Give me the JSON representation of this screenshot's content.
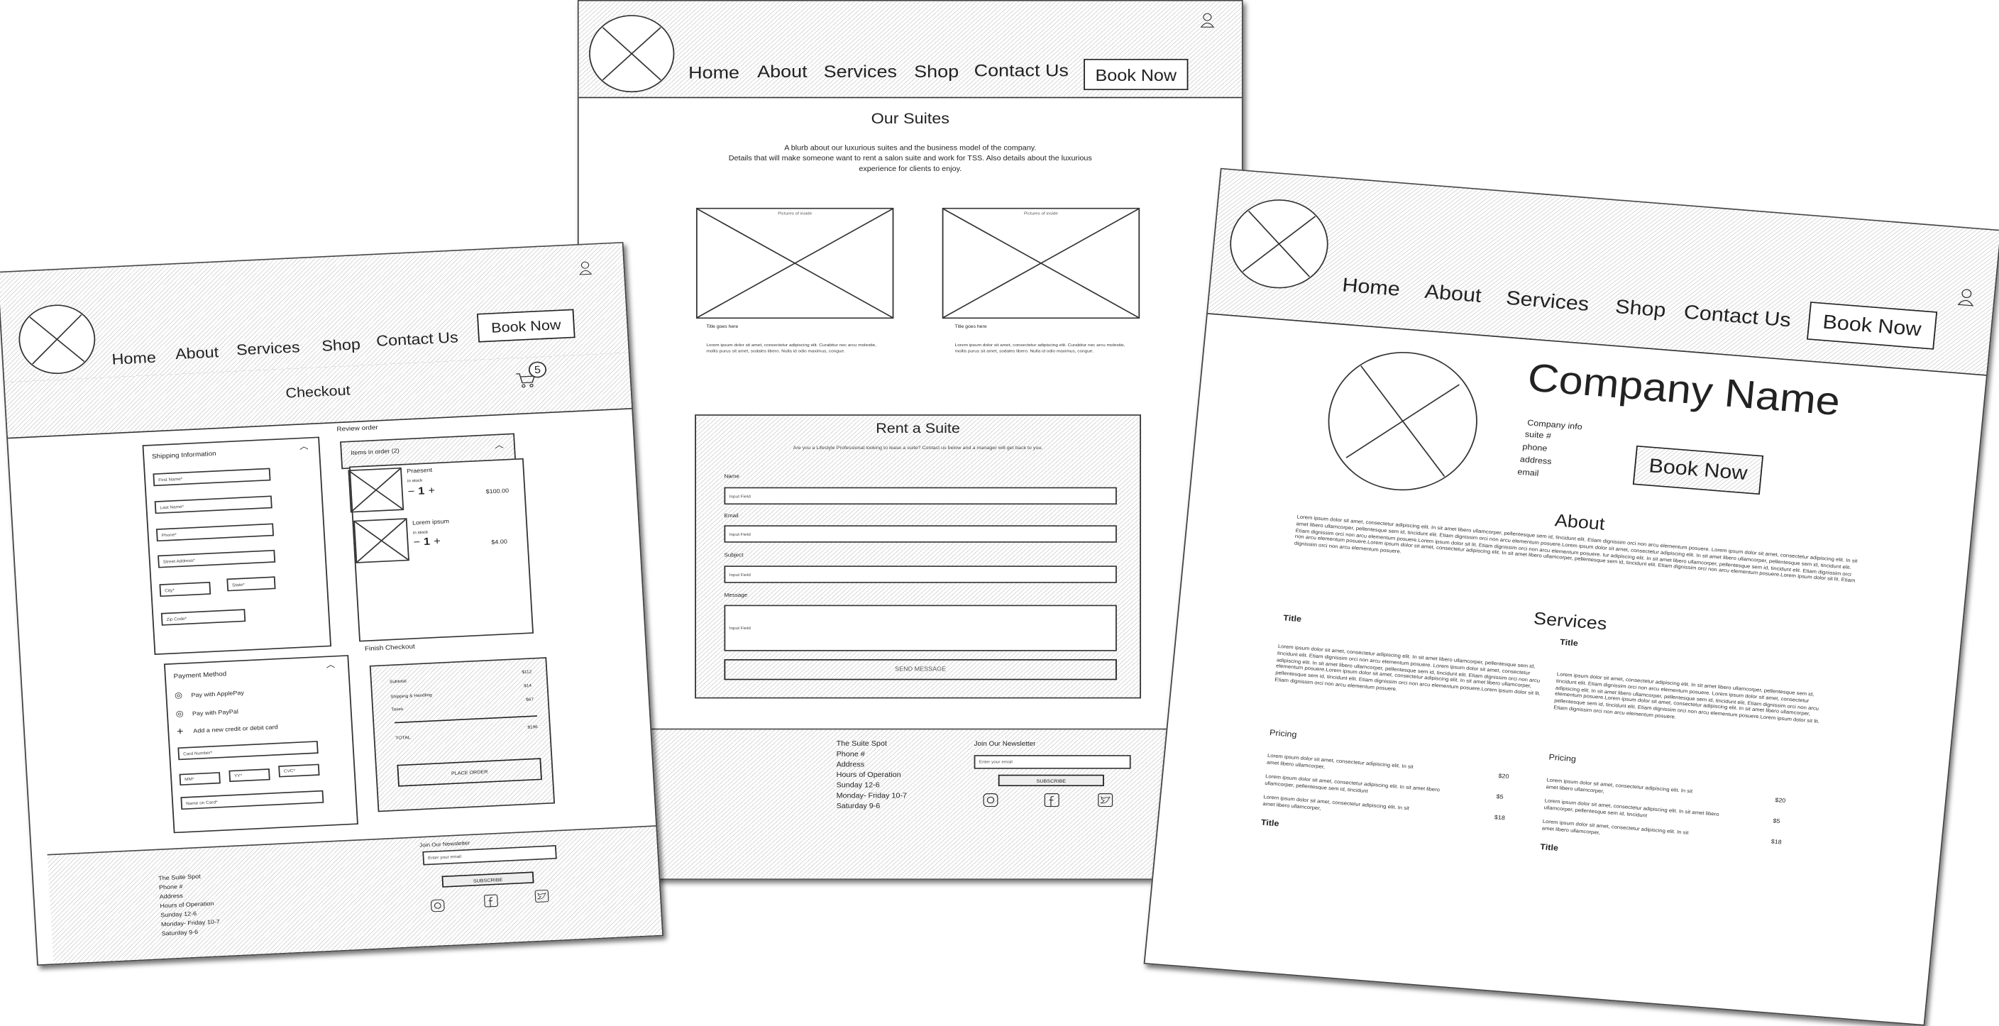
{
  "nav": [
    "Home",
    "About",
    "Services",
    "Shop",
    "Contact Us"
  ],
  "book_now": "Book Now",
  "footer": {
    "lines": [
      "The Suite Spot",
      "Phone #",
      "Address",
      "Hours of Operation",
      "Sunday 12-6",
      "Monday- Friday 10-7",
      "Saturday 9-6"
    ],
    "newsletter_label": "Join Our Newsletter",
    "email_placeholder": "Enter your email",
    "subscribe": "SUBSCRIBE",
    "social_icons": [
      "instagram-icon",
      "facebook-icon",
      "twitter-icon"
    ]
  },
  "checkout_page": {
    "title": "Checkout",
    "cart_count": "5",
    "shipping": {
      "title": "Shipping Information",
      "fields": [
        "First Name*",
        "Last Name*",
        "Phone*",
        "Street Address*",
        "City*",
        "State*",
        "Zip Code*"
      ]
    },
    "review": {
      "label": "Review order",
      "items_header": "Items in order (2)",
      "items": [
        {
          "name": "Praesent",
          "stock": "in stock",
          "qty": "1",
          "price": "$100.00"
        },
        {
          "name": "Lorem ipsum",
          "stock": "in stock",
          "qty": "1",
          "price": "$4.00"
        }
      ]
    },
    "payment": {
      "title": "Payment Method",
      "options": [
        "Pay with ApplePay",
        "Pay with PayPal"
      ],
      "add_card": "Add a new credit or debit card",
      "fields": [
        "Card Number*",
        "MM*",
        "YY*",
        "CVC*",
        "Name on Card*"
      ]
    },
    "finish": {
      "label": "Finish Checkout",
      "rows": [
        {
          "label": "Subtotal",
          "value": "$112"
        },
        {
          "label": "Shipping & Handling",
          "value": "$14"
        },
        {
          "label": "Taxes",
          "value": "$67"
        }
      ],
      "total_label": "TOTAL",
      "total_value": "$196",
      "place_order": "PLACE ORDER"
    }
  },
  "suites_page": {
    "title": "Our Suites",
    "blurb": [
      "A blurb about our luxurious suites and the business model of the company.",
      "Details that will make someone want to rent a salon suite and work for TSS. Also details about the luxurious",
      "experience for clients to enjoy."
    ],
    "cards": [
      {
        "caption": "Pictures of inside",
        "title": "Title goes here",
        "text": "Lorem ipsum dolor sit amet, consectetur adipiscing elit. Curabitur nec arcu molestie, mollis purus sit amet, sodales libero. Nulla id odio maximus, congue."
      },
      {
        "caption": "Pictures of inside",
        "title": "Title goes here",
        "text": "Lorem ipsum dolor sit amet, consectetur adipiscing elit. Curabitur nec arcu molestie, mollis purus sit amet, sodales libero. Nulla id odio maximus, congue."
      }
    ],
    "rent": {
      "title": "Rent a Suite",
      "subtitle": "Are you a Lifestyle Professional looking to lease a suite? Contact us below and a manager will get back to you.",
      "fields": [
        {
          "label": "Name",
          "placeholder": "Input Field"
        },
        {
          "label": "Email",
          "placeholder": "Input Field"
        },
        {
          "label": "Subject",
          "placeholder": "Input Field"
        },
        {
          "label": "Message",
          "placeholder": "Input Field"
        }
      ],
      "send": "SEND MESSAGE"
    }
  },
  "home_page": {
    "company_name": "Company Name",
    "info": [
      "Company info",
      "suite #",
      "phone",
      "address",
      "email"
    ],
    "about_title": "About",
    "about_text": "Lorem ipsum dolor sit amet, consectetur adipiscing elit. In sit amet libero ullamcorper, pellentesque sem id, tincidunt elit. Etiam dignissim orci non arcu elementum posuere. Lorem ipsum dolor sit amet, consectetur adipiscing elit. In sit amet libero ullamcorper, pellentesque sem id, tincidunt elit. Etiam dignissim orci non arcu elementum posuere.Lorem ipsum dolor sit amet, consectetur adipiscing elit. In sit amet libero ullamcorper, pellentesque sem id, tincidunt elit. Etiam dignissim orci non arcu elementum posuere.Lorem ipsum dolor sit lit. Etiam dignissim orci non arcu elementum posuere. tur adipiscing elit. In sit amet libero ullamcorper, pellentesque sem id, tincidunt elit. Etiam dignissim orci non arcu elementum posuere.Lorem ipsum dolor sit amet, consectetur adipiscing elit. In sit amet libero ullamcorper, pellentesque sem id, tincidunt elit. Etiam dignissim orci non arcu elementum posuere.Lorem ipsum dolor sit lit. Etiam dignissim orci non arcu elementum posuere.",
    "services_title": "Services",
    "columns": [
      {
        "title": "Title",
        "text": "Lorem ipsum dolor sit amet, consectetur adipiscing elit. In sit amet libero ullamcorper, pellentesque sem id, tincidunt elit. Etiam dignissim orci non arcu elementum posuere. Lorem ipsum dolor sit amet, consectetur adipiscing elit. In sit amet libero ullamcorper, pellentesque sem id, tincidunt elit. Etiam dignissim orci non arcu elementum posuere.Lorem ipsum dolor sit amet, consectetur adipiscing elit. In sit amet libero ullamcorper, pellentesque sem id, tincidunt elit. Etiam dignissim orci non arcu elementum posuere.Lorem ipsum dolor sit lit. Etiam dignissim orci non arcu elementum posuere.",
        "pricing_title": "Pricing",
        "prices": [
          {
            "text": "Lorem ipsum dolor sit amet, consectetur adipiscing elit. In sit amet libero ullamcorper,",
            "price": "$20"
          },
          {
            "text": "Lorem ipsum dolor sit amet, consectetur adipiscing elit. In sit amet libero ullamcorper, pellentesque sem id, tincidunt",
            "price": "$5"
          },
          {
            "text": "Lorem ipsum dolor sit amet, consectetur adipiscing elit. In sit amet libero ullamcorper,",
            "price": "$18"
          }
        ],
        "next_title": "Title"
      },
      {
        "title": "Title",
        "text": "Lorem ipsum dolor sit amet, consectetur adipiscing elit. In sit amet libero ullamcorper, pellentesque sem id, tincidunt elit. Etiam dignissim orci non arcu elementum posuere. Lorem ipsum dolor sit amet, consectetur adipiscing elit. In sit amet libero ullamcorper, pellentesque sem id, tincidunt elit. Etiam dignissim orci non arcu elementum posuere.Lorem ipsum dolor sit amet, consectetur adipiscing elit. In sit amet libero ullamcorper, pellentesque sem id, tincidunt elit. Etiam dignissim orci non arcu elementum posuere.Lorem ipsum dolor sit lit. Etiam dignissim orci non arcu elementum posuere.",
        "pricing_title": "Pricing",
        "prices": [
          {
            "text": "Lorem ipsum dolor sit amet, consectetur adipiscing elit. In sit amet libero ullamcorper,",
            "price": "$20"
          },
          {
            "text": "Lorem ipsum dolor sit amet, consectetur adipiscing elit. In sit amet libero ullamcorper, pellentesque sem id, tincidunt",
            "price": "$5"
          },
          {
            "text": "Lorem ipsum dolor sit amet, consectetur adipiscing elit. In sit amet libero ullamcorper,",
            "price": "$18"
          }
        ],
        "next_title": "Title"
      }
    ]
  }
}
